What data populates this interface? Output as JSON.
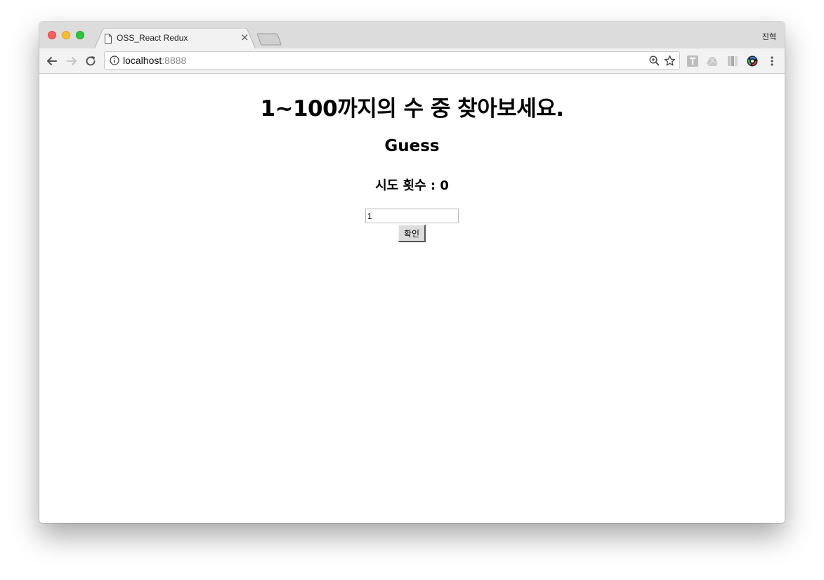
{
  "browser": {
    "tab_title": "OSS_React Redux",
    "tab_close": "×",
    "profile_name": "진혁",
    "url_host": "localhost",
    "url_port": ":8888"
  },
  "page": {
    "heading": "1~100까지의 수 중 찾아보세요.",
    "subheading": "Guess",
    "attempts_label": "시도 횟수 : 0",
    "input_value": "1",
    "confirm_label": "확인"
  },
  "icons": {
    "back": "arrow-left-icon",
    "forward": "arrow-right-icon",
    "reload": "reload-icon",
    "info": "info-icon",
    "zoom": "zoom-in-icon",
    "bookmark": "star-icon",
    "menu": "kebab-menu-icon"
  },
  "colors": {
    "traffic_close": "#fc5f57",
    "traffic_minimize": "#fdbc2e",
    "traffic_maximize": "#28c840"
  }
}
